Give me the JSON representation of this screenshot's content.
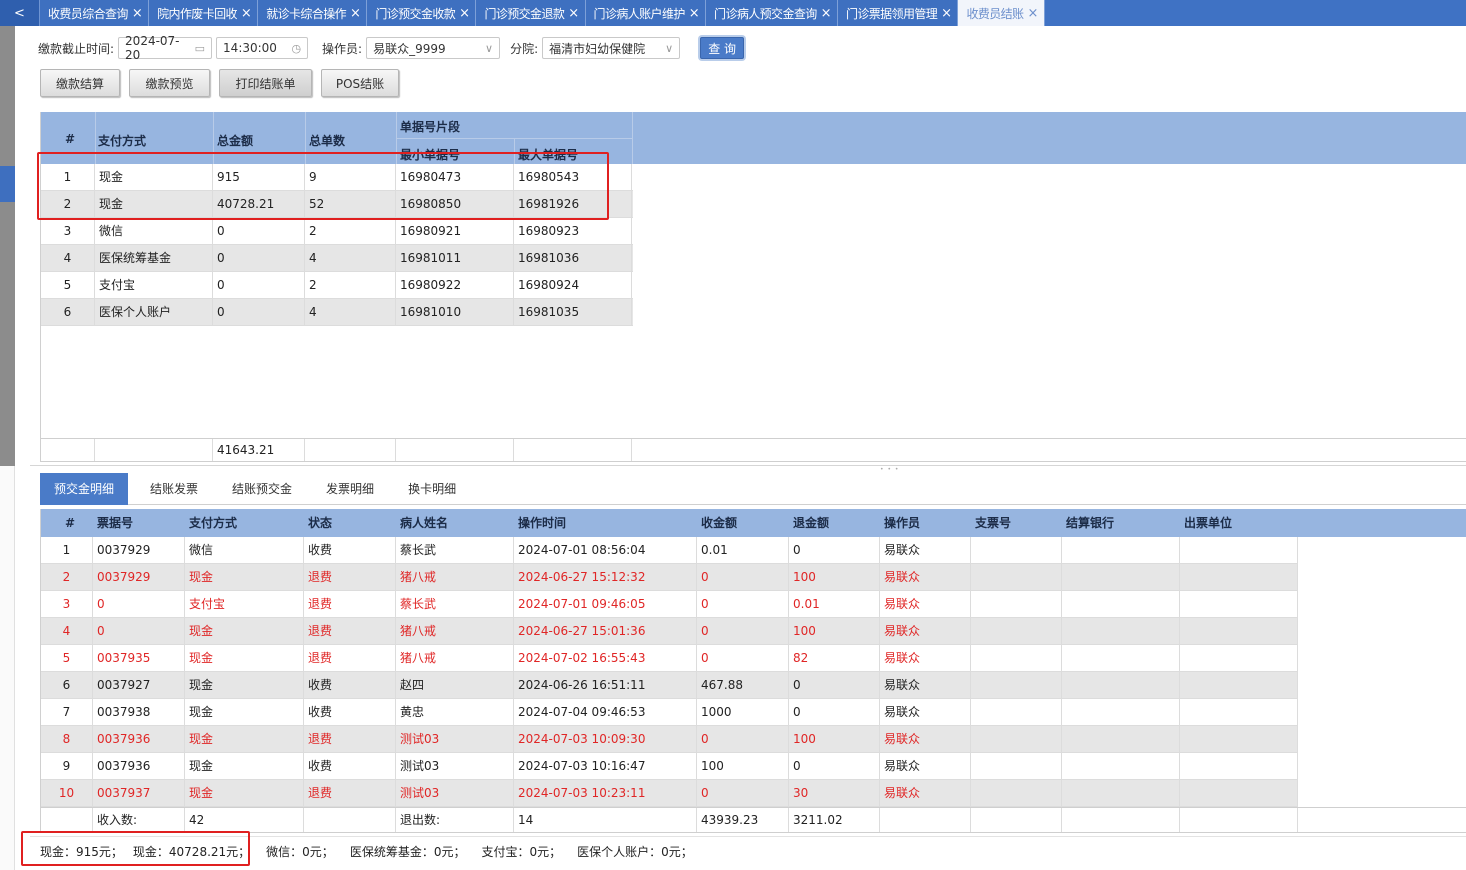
{
  "tabs": {
    "back_icon": "chevron-left-icon",
    "back_glyph": "<",
    "close_glyph": "×",
    "items": [
      {
        "label": "收费员综合查询",
        "active": false
      },
      {
        "label": "院内作废卡回收",
        "active": false
      },
      {
        "label": "就诊卡综合操作",
        "active": false
      },
      {
        "label": "门诊预交金收款",
        "active": false
      },
      {
        "label": "门诊预交金退款",
        "active": false
      },
      {
        "label": "门诊病人账户维护",
        "active": false
      },
      {
        "label": "门诊病人预交金查询",
        "active": false
      },
      {
        "label": "门诊票据领用管理",
        "active": false
      },
      {
        "label": "收费员结账",
        "active": true
      }
    ]
  },
  "filters": {
    "deadline_label": "缴款截止时间:",
    "date_value": "2024-07-20",
    "date_icon": "calendar-icon",
    "time_value": "14:30:00",
    "time_icon": "clock-icon",
    "operator_label": "操作员:",
    "operator_value": "易联众_9999",
    "branch_label": "分院:",
    "branch_value": "福清市妇幼保健院",
    "dropdown_glyph": "∨",
    "query_label": "查 询"
  },
  "actions": {
    "settle": "缴款结算",
    "preview": "缴款预览",
    "print": "打印结账单",
    "pos": "POS结账"
  },
  "summary_grid": {
    "headers": {
      "index": "#",
      "pay_method": "支付方式",
      "total_amount": "总金额",
      "total_count": "总单数",
      "range_group": "单据号片段",
      "min_no": "最小单据号",
      "max_no": "最大单据号"
    },
    "rows": [
      {
        "index": "1",
        "pay_method": "现金",
        "total_amount": "915",
        "total_count": "9",
        "min_no": "16980473",
        "max_no": "16980543"
      },
      {
        "index": "2",
        "pay_method": "现金",
        "total_amount": "40728.21",
        "total_count": "52",
        "min_no": "16980850",
        "max_no": "16981926"
      },
      {
        "index": "3",
        "pay_method": "微信",
        "total_amount": "0",
        "total_count": "2",
        "min_no": "16980921",
        "max_no": "16980923"
      },
      {
        "index": "4",
        "pay_method": "医保统筹基金",
        "total_amount": "0",
        "total_count": "4",
        "min_no": "16981011",
        "max_no": "16981036"
      },
      {
        "index": "5",
        "pay_method": "支付宝",
        "total_amount": "0",
        "total_count": "2",
        "min_no": "16980922",
        "max_no": "16980924"
      },
      {
        "index": "6",
        "pay_method": "医保个人账户",
        "total_amount": "0",
        "total_count": "4",
        "min_no": "16981010",
        "max_no": "16981035"
      }
    ],
    "footer_total": "41643.21"
  },
  "lower_tabs": [
    "预交金明细",
    "结账发票",
    "结账预交金",
    "发票明细",
    "换卡明细"
  ],
  "detail_grid": {
    "headers": {
      "index": "#",
      "ticket_no": "票据号",
      "pay_method": "支付方式",
      "status": "状态",
      "patient": "病人姓名",
      "op_time": "操作时间",
      "received": "收金额",
      "refunded": "退金额",
      "operator": "操作员",
      "check_no": "支票号",
      "bank": "结算银行",
      "issuer": "出票单位"
    },
    "rows": [
      {
        "index": "1",
        "ticket_no": "0037929",
        "pay_method": "微信",
        "status": "收费",
        "patient": "蔡长武",
        "op_time": "2024-07-01 08:56:04",
        "received": "0.01",
        "refunded": "0",
        "operator": "易联众",
        "refund": false
      },
      {
        "index": "2",
        "ticket_no": "0037929",
        "pay_method": "现金",
        "status": "退费",
        "patient": "猪八戒",
        "op_time": "2024-06-27 15:12:32",
        "received": "0",
        "refunded": "100",
        "operator": "易联众",
        "refund": true
      },
      {
        "index": "3",
        "ticket_no": "0",
        "pay_method": "支付宝",
        "status": "退费",
        "patient": "蔡长武",
        "op_time": "2024-07-01 09:46:05",
        "received": "0",
        "refunded": "0.01",
        "operator": "易联众",
        "refund": true
      },
      {
        "index": "4",
        "ticket_no": "0",
        "pay_method": "现金",
        "status": "退费",
        "patient": "猪八戒",
        "op_time": "2024-06-27 15:01:36",
        "received": "0",
        "refunded": "100",
        "operator": "易联众",
        "refund": true
      },
      {
        "index": "5",
        "ticket_no": "0037935",
        "pay_method": "现金",
        "status": "退费",
        "patient": "猪八戒",
        "op_time": "2024-07-02 16:55:43",
        "received": "0",
        "refunded": "82",
        "operator": "易联众",
        "refund": true
      },
      {
        "index": "6",
        "ticket_no": "0037927",
        "pay_method": "现金",
        "status": "收费",
        "patient": "赵四",
        "op_time": "2024-06-26 16:51:11",
        "received": "467.88",
        "refunded": "0",
        "operator": "易联众",
        "refund": false
      },
      {
        "index": "7",
        "ticket_no": "0037938",
        "pay_method": "现金",
        "status": "收费",
        "patient": "黄忠",
        "op_time": "2024-07-04 09:46:53",
        "received": "1000",
        "refunded": "0",
        "operator": "易联众",
        "refund": false
      },
      {
        "index": "8",
        "ticket_no": "0037936",
        "pay_method": "现金",
        "status": "退费",
        "patient": "测试03",
        "op_time": "2024-07-03 10:09:30",
        "received": "0",
        "refunded": "100",
        "operator": "易联众",
        "refund": true
      },
      {
        "index": "9",
        "ticket_no": "0037936",
        "pay_method": "现金",
        "status": "收费",
        "patient": "测试03",
        "op_time": "2024-07-03 10:16:47",
        "received": "100",
        "refunded": "0",
        "operator": "易联众",
        "refund": false
      },
      {
        "index": "10",
        "ticket_no": "0037937",
        "pay_method": "现金",
        "status": "退费",
        "patient": "测试03",
        "op_time": "2024-07-03 10:23:11",
        "received": "0",
        "refunded": "30",
        "operator": "易联众",
        "refund": true
      }
    ],
    "footer": {
      "income_label": "收入数:",
      "income_count": "42",
      "refund_label": "退出数:",
      "refund_count": "14",
      "received_total": "43939.23",
      "refunded_total": "3211.02"
    }
  },
  "statusbar": {
    "items": [
      "现金：915元；",
      "现金：40728.21元；",
      "微信：0元；",
      "医保统筹基金：0元；",
      "支付宝：0元；",
      "医保个人账户：0元；"
    ]
  },
  "colors": {
    "accent": "#4a7bc8",
    "header_bg": "#97b5e0",
    "refund_text": "#e02626",
    "highlight_box": "#e02020"
  }
}
